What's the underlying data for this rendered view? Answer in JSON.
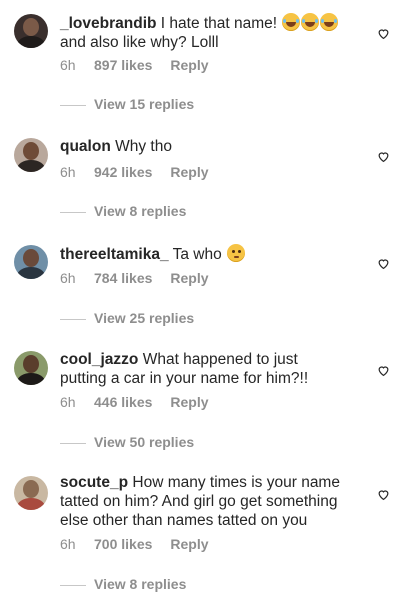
{
  "comments": [
    {
      "username": "_lovebrandib",
      "text": "I hate that name!",
      "text_cont": "and also like why? Lolll",
      "emojis": [
        "face-with-tears-of-joy",
        "face-with-tears-of-joy",
        "face-with-tears-of-joy"
      ],
      "time": "6h",
      "likes": "897 likes",
      "reply": "Reply",
      "view_replies": "View 15 replies",
      "avatar_colors": {
        "bg": "#3a2f2d",
        "head": "#7b5a48",
        "body": "#1f1b1a"
      }
    },
    {
      "username": "qualon",
      "text": "Why tho",
      "time": "6h",
      "likes": "942 likes",
      "reply": "Reply",
      "view_replies": "View 8 replies",
      "avatar_colors": {
        "bg": "#b9a89c",
        "head": "#6e4b37",
        "body": "#2c2623"
      }
    },
    {
      "username": "thereeltamika_",
      "text": "Ta who",
      "emojis": [
        "flushed-face"
      ],
      "time": "6h",
      "likes": "784 likes",
      "reply": "Reply",
      "view_replies": "View 25 replies",
      "avatar_colors": {
        "bg": "#6f8fa7",
        "head": "#6a4a3a",
        "body": "#2a3540"
      }
    },
    {
      "username": "cool_jazzo",
      "text": "What happened to just",
      "text_cont": "putting a car in your name for him?!!",
      "time": "6h",
      "likes": "446 likes",
      "reply": "Reply",
      "view_replies": "View 50 replies",
      "avatar_colors": {
        "bg": "#8a9a6a",
        "head": "#5a3d2c",
        "body": "#1d1a18"
      }
    },
    {
      "username": "socute_p",
      "text": "How many times is your name",
      "text_cont": "tatted on him? And girl go get something",
      "text_cont2": "else other than names tatted on you",
      "time": "6h",
      "likes": "700 likes",
      "reply": "Reply",
      "view_replies": "View 8 replies",
      "avatar_colors": {
        "bg": "#c9b8a2",
        "head": "#8a6a52",
        "body": "#a94a3e"
      }
    }
  ],
  "icons": {
    "like": "heart-outline-icon"
  }
}
